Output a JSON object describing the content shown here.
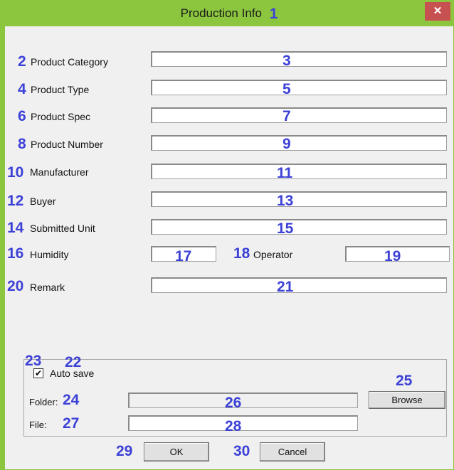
{
  "window": {
    "title": "Production Info",
    "close_glyph": "✕",
    "colors": {
      "frame": "#8cc63e",
      "close": "#c75050",
      "annotation": "#3c41d6"
    }
  },
  "fields": {
    "product_category": {
      "label": "Product Category",
      "value": ""
    },
    "product_type": {
      "label": "Product Type",
      "value": ""
    },
    "product_spec": {
      "label": "Product Spec",
      "value": ""
    },
    "product_number": {
      "label": "Product Number",
      "value": ""
    },
    "manufacturer": {
      "label": "Manufacturer",
      "value": ""
    },
    "buyer": {
      "label": "Buyer",
      "value": ""
    },
    "submitted_unit": {
      "label": "Submitted Unit",
      "value": ""
    },
    "humidity": {
      "label": "Humidity",
      "value": ""
    },
    "operator": {
      "label": "Operator",
      "value": ""
    },
    "remark": {
      "label": "Remark",
      "value": ""
    }
  },
  "autosave": {
    "label": "Auto save",
    "checked": true,
    "check_glyph": "✔"
  },
  "folder": {
    "label": "Folder:",
    "value": ""
  },
  "file": {
    "label": "File:",
    "value": ""
  },
  "buttons": {
    "browse": "Browse",
    "ok": "OK",
    "cancel": "Cancel"
  },
  "annotations": {
    "n1": "1",
    "n2": "2",
    "n3": "3",
    "n4": "4",
    "n5": "5",
    "n6": "6",
    "n7": "7",
    "n8": "8",
    "n9": "9",
    "n10": "10",
    "n11": "11",
    "n12": "12",
    "n13": "13",
    "n14": "14",
    "n15": "15",
    "n16": "16",
    "n17": "17",
    "n18": "18",
    "n19": "19",
    "n20": "20",
    "n21": "21",
    "n22": "22",
    "n23": "23",
    "n24": "24",
    "n25": "25",
    "n26": "26",
    "n27": "27",
    "n28": "28",
    "n29": "29",
    "n30": "30"
  }
}
